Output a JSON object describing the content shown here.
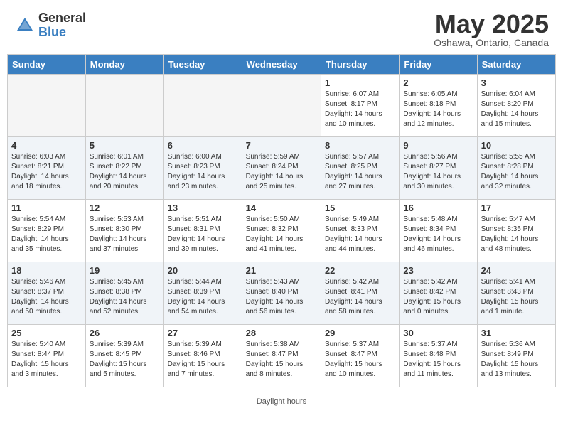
{
  "header": {
    "logo_general": "General",
    "logo_blue": "Blue",
    "month_title": "May 2025",
    "location": "Oshawa, Ontario, Canada"
  },
  "days_of_week": [
    "Sunday",
    "Monday",
    "Tuesday",
    "Wednesday",
    "Thursday",
    "Friday",
    "Saturday"
  ],
  "weeks": [
    [
      {
        "num": "",
        "info": "",
        "empty": true
      },
      {
        "num": "",
        "info": "",
        "empty": true
      },
      {
        "num": "",
        "info": "",
        "empty": true
      },
      {
        "num": "",
        "info": "",
        "empty": true
      },
      {
        "num": "1",
        "info": "Sunrise: 6:07 AM\nSunset: 8:17 PM\nDaylight: 14 hours\nand 10 minutes.",
        "empty": false
      },
      {
        "num": "2",
        "info": "Sunrise: 6:05 AM\nSunset: 8:18 PM\nDaylight: 14 hours\nand 12 minutes.",
        "empty": false
      },
      {
        "num": "3",
        "info": "Sunrise: 6:04 AM\nSunset: 8:20 PM\nDaylight: 14 hours\nand 15 minutes.",
        "empty": false
      }
    ],
    [
      {
        "num": "4",
        "info": "Sunrise: 6:03 AM\nSunset: 8:21 PM\nDaylight: 14 hours\nand 18 minutes.",
        "empty": false
      },
      {
        "num": "5",
        "info": "Sunrise: 6:01 AM\nSunset: 8:22 PM\nDaylight: 14 hours\nand 20 minutes.",
        "empty": false
      },
      {
        "num": "6",
        "info": "Sunrise: 6:00 AM\nSunset: 8:23 PM\nDaylight: 14 hours\nand 23 minutes.",
        "empty": false
      },
      {
        "num": "7",
        "info": "Sunrise: 5:59 AM\nSunset: 8:24 PM\nDaylight: 14 hours\nand 25 minutes.",
        "empty": false
      },
      {
        "num": "8",
        "info": "Sunrise: 5:57 AM\nSunset: 8:25 PM\nDaylight: 14 hours\nand 27 minutes.",
        "empty": false
      },
      {
        "num": "9",
        "info": "Sunrise: 5:56 AM\nSunset: 8:27 PM\nDaylight: 14 hours\nand 30 minutes.",
        "empty": false
      },
      {
        "num": "10",
        "info": "Sunrise: 5:55 AM\nSunset: 8:28 PM\nDaylight: 14 hours\nand 32 minutes.",
        "empty": false
      }
    ],
    [
      {
        "num": "11",
        "info": "Sunrise: 5:54 AM\nSunset: 8:29 PM\nDaylight: 14 hours\nand 35 minutes.",
        "empty": false
      },
      {
        "num": "12",
        "info": "Sunrise: 5:53 AM\nSunset: 8:30 PM\nDaylight: 14 hours\nand 37 minutes.",
        "empty": false
      },
      {
        "num": "13",
        "info": "Sunrise: 5:51 AM\nSunset: 8:31 PM\nDaylight: 14 hours\nand 39 minutes.",
        "empty": false
      },
      {
        "num": "14",
        "info": "Sunrise: 5:50 AM\nSunset: 8:32 PM\nDaylight: 14 hours\nand 41 minutes.",
        "empty": false
      },
      {
        "num": "15",
        "info": "Sunrise: 5:49 AM\nSunset: 8:33 PM\nDaylight: 14 hours\nand 44 minutes.",
        "empty": false
      },
      {
        "num": "16",
        "info": "Sunrise: 5:48 AM\nSunset: 8:34 PM\nDaylight: 14 hours\nand 46 minutes.",
        "empty": false
      },
      {
        "num": "17",
        "info": "Sunrise: 5:47 AM\nSunset: 8:35 PM\nDaylight: 14 hours\nand 48 minutes.",
        "empty": false
      }
    ],
    [
      {
        "num": "18",
        "info": "Sunrise: 5:46 AM\nSunset: 8:37 PM\nDaylight: 14 hours\nand 50 minutes.",
        "empty": false
      },
      {
        "num": "19",
        "info": "Sunrise: 5:45 AM\nSunset: 8:38 PM\nDaylight: 14 hours\nand 52 minutes.",
        "empty": false
      },
      {
        "num": "20",
        "info": "Sunrise: 5:44 AM\nSunset: 8:39 PM\nDaylight: 14 hours\nand 54 minutes.",
        "empty": false
      },
      {
        "num": "21",
        "info": "Sunrise: 5:43 AM\nSunset: 8:40 PM\nDaylight: 14 hours\nand 56 minutes.",
        "empty": false
      },
      {
        "num": "22",
        "info": "Sunrise: 5:42 AM\nSunset: 8:41 PM\nDaylight: 14 hours\nand 58 minutes.",
        "empty": false
      },
      {
        "num": "23",
        "info": "Sunrise: 5:42 AM\nSunset: 8:42 PM\nDaylight: 15 hours\nand 0 minutes.",
        "empty": false
      },
      {
        "num": "24",
        "info": "Sunrise: 5:41 AM\nSunset: 8:43 PM\nDaylight: 15 hours\nand 1 minute.",
        "empty": false
      }
    ],
    [
      {
        "num": "25",
        "info": "Sunrise: 5:40 AM\nSunset: 8:44 PM\nDaylight: 15 hours\nand 3 minutes.",
        "empty": false
      },
      {
        "num": "26",
        "info": "Sunrise: 5:39 AM\nSunset: 8:45 PM\nDaylight: 15 hours\nand 5 minutes.",
        "empty": false
      },
      {
        "num": "27",
        "info": "Sunrise: 5:39 AM\nSunset: 8:46 PM\nDaylight: 15 hours\nand 7 minutes.",
        "empty": false
      },
      {
        "num": "28",
        "info": "Sunrise: 5:38 AM\nSunset: 8:47 PM\nDaylight: 15 hours\nand 8 minutes.",
        "empty": false
      },
      {
        "num": "29",
        "info": "Sunrise: 5:37 AM\nSunset: 8:47 PM\nDaylight: 15 hours\nand 10 minutes.",
        "empty": false
      },
      {
        "num": "30",
        "info": "Sunrise: 5:37 AM\nSunset: 8:48 PM\nDaylight: 15 hours\nand 11 minutes.",
        "empty": false
      },
      {
        "num": "31",
        "info": "Sunrise: 5:36 AM\nSunset: 8:49 PM\nDaylight: 15 hours\nand 13 minutes.",
        "empty": false
      }
    ]
  ],
  "footer": {
    "note": "Daylight hours"
  }
}
